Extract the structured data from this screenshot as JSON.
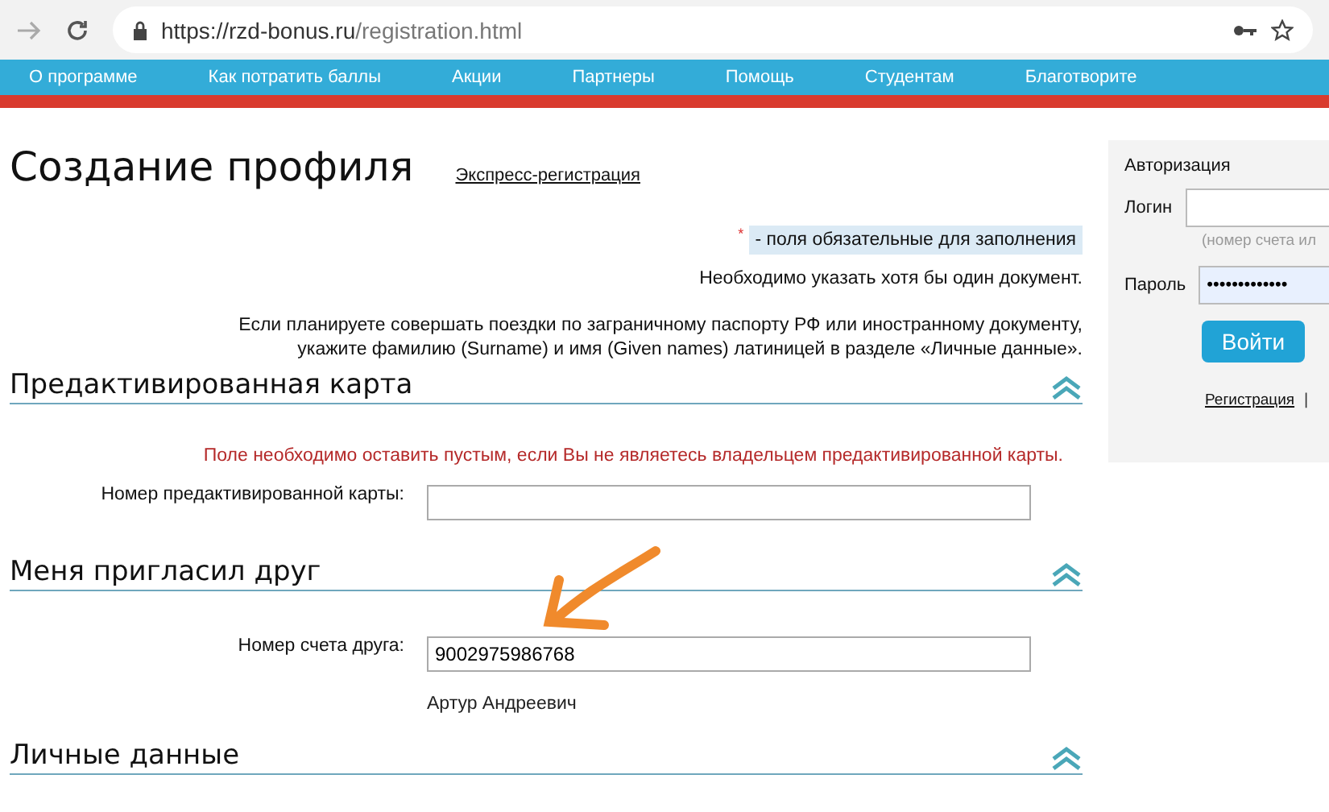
{
  "browser": {
    "url_host": "https://rzd-bonus.ru",
    "url_path": "/registration.html"
  },
  "nav": [
    "О программе",
    "Как потратить баллы",
    "Акции",
    "Партнеры",
    "Помощь",
    "Студентам",
    "Благотворите"
  ],
  "page": {
    "title": "Создание профиля",
    "express_link": "Экспресс-регистрация",
    "required_mark": "*",
    "required_note": "- поля обязательные для заполнения",
    "doc_note": "Необходимо указать хотя бы один документ.",
    "passport_note": "Если планируете совершать поездки по заграничному паспорту РФ или иностранному документу, укажите фамилию (Surname) и имя (Given names) латиницей в разделе «Личные данные».",
    "sections": [
      {
        "title": "Предактивированная карта",
        "expanded": true,
        "warning": "Поле необходимо оставить пустым, если Вы не являетесь владельцем предактивированной карты.",
        "field": {
          "label": "Номер предактивированной карты:"
        }
      },
      {
        "title": "Меня пригласил друг",
        "expanded": true,
        "field": {
          "label": "Номер счета друга:",
          "value": "9002975986768"
        },
        "hint": "Артур Андреевич"
      },
      {
        "title": "Личные данные",
        "expanded": true
      }
    ]
  },
  "auth": {
    "title": "Авторизация",
    "login_label": "Логин",
    "login_hint": "(номер счета ил",
    "password_label": "Пароль",
    "password_value": "•••••••••••••",
    "submit": "Войти",
    "register_link": "Регистрация",
    "separator": "|"
  }
}
